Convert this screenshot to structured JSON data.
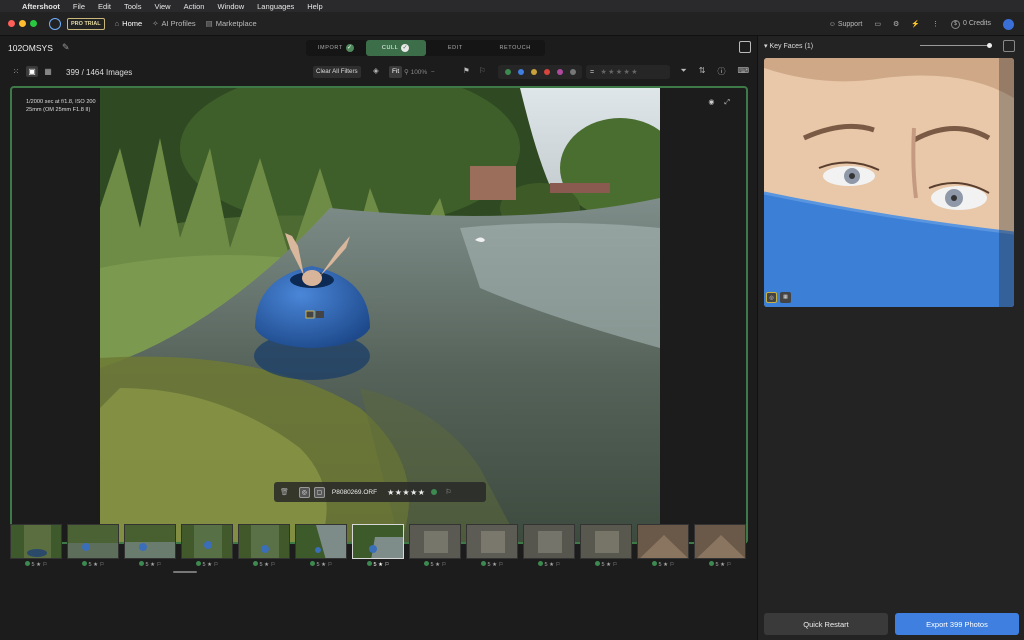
{
  "menubar": {
    "apple": "",
    "app": "Aftershoot",
    "items": [
      "File",
      "Edit",
      "Tools",
      "View",
      "Action",
      "Window",
      "Languages",
      "Help"
    ]
  },
  "toolbar": {
    "badge": "PRO TRIAL",
    "nav": [
      {
        "label": "Home",
        "icon": "home-icon"
      },
      {
        "label": "AI Profiles",
        "icon": "ai-profiles-icon"
      },
      {
        "label": "Marketplace",
        "icon": "marketplace-icon"
      }
    ],
    "support": "Support",
    "credits": "0 Credits",
    "coin": "$"
  },
  "colors": {
    "traffic": [
      "#ff5f57",
      "#febc2e",
      "#28c840"
    ],
    "accent_green": "#3c6e4a",
    "accent_blue": "#3f7fe0"
  },
  "workspace": {
    "folder": "102OMSYS",
    "modes": [
      "IMPORT",
      "CULL",
      "EDIT",
      "RETOUCH"
    ],
    "active_mode": "CULL"
  },
  "filterbar": {
    "count": "399 / 1464 Images",
    "clear": "Clear All Filters",
    "fit": "Fit",
    "zoom": "100%",
    "color_labels": [
      "#3d8a50",
      "#3f7fe0",
      "#c8a23a",
      "#d8453c",
      "#b04a9c",
      "#777777"
    ],
    "equals": "=",
    "stars": "★★★★★"
  },
  "viewer": {
    "exif_line1": "1/2000 sec at f/1.8, ISO 200",
    "exif_line2": "25mm (OM 25mm F1.8 II)",
    "filename": "P8080269.ORF",
    "rating": 5,
    "stars": "★★★★★"
  },
  "filmstrip": [
    {
      "rating": "5",
      "star": "★"
    },
    {
      "rating": "5",
      "star": "★"
    },
    {
      "rating": "5",
      "star": "★"
    },
    {
      "rating": "5",
      "star": "★"
    },
    {
      "rating": "5",
      "star": "★"
    },
    {
      "rating": "5",
      "star": "★"
    },
    {
      "rating": "5",
      "star": "★"
    },
    {
      "rating": "5",
      "star": "★"
    },
    {
      "rating": "5",
      "star": "★"
    },
    {
      "rating": "5",
      "star": "★"
    },
    {
      "rating": "5",
      "star": "★"
    },
    {
      "rating": "5",
      "star": "★"
    },
    {
      "rating": "5",
      "star": "★"
    }
  ],
  "right_panel": {
    "title": "Key Faces (1)",
    "quick_restart": "Quick Restart",
    "export": "Export 399 Photos"
  }
}
